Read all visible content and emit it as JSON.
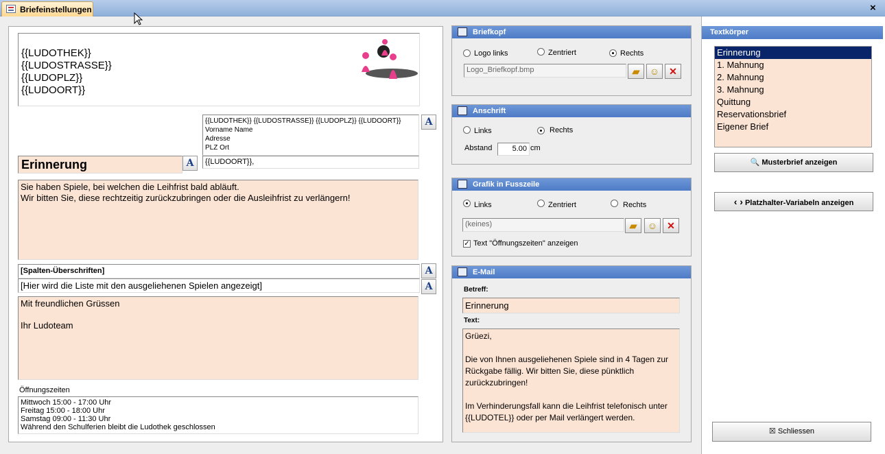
{
  "window": {
    "tab_title": "Briefeinstellungen",
    "close_glyph": "×"
  },
  "letter": {
    "header_lines": [
      "{{LUDOTHEK}}",
      "{{LUDOSTRASSE}}",
      "{{LUDOPLZ}}",
      "{{LUDOORT}}"
    ],
    "address_lines": [
      "{{LUDOTHEK}} {{LUDOSTRASSE}} {{LUDOPLZ}} {{LUDOORT}}",
      "Vorname Name",
      "Adresse",
      "PLZ Ort"
    ],
    "place_date": "{{LUDOORT}},",
    "subject": "Erinnerung",
    "body": "Sie haben Spiele, bei welchen die Leihfrist bald abläuft.\nWir bitten Sie, diese rechtzeitig zurückzubringen oder die Ausleihfrist zu verlängern!",
    "columns_header": "[Spalten-Überschriften]",
    "list_placeholder": "[Hier wird die Liste mit den ausgeliehenen Spielen angezeigt]",
    "closing": "Mit freundlichen Grüssen\n\nIhr Ludoteam",
    "hours_label": "Öffnungszeiten",
    "hours_lines": [
      "Mittwoch 15:00 - 17:00 Uhr",
      "Freitag 15:00 - 18:00 Uhr",
      "Samstag 09:00 - 11:30 Uhr",
      "Während den Schulferien bleibt die Ludothek geschlossen"
    ],
    "font_button": "A"
  },
  "briefkopf": {
    "title": "Briefkopf",
    "options": [
      "Logo links",
      "Zentriert",
      "Rechts"
    ],
    "selected": "Rechts",
    "file": "Logo_Briefkopf.bmp"
  },
  "anschrift": {
    "title": "Anschrift",
    "options": [
      "Links",
      "Rechts"
    ],
    "selected": "Rechts",
    "distance_label": "Abstand",
    "distance_value": "5.00",
    "distance_unit": "cm"
  },
  "fusszeile": {
    "title": "Grafik in Fusszeile",
    "options": [
      "Links",
      "Zentriert",
      "Rechts"
    ],
    "selected": "Links",
    "file": "(keines)",
    "checkbox_label": "Text \"Öffnungszeiten\" anzeigen",
    "checkbox_checked": true
  },
  "email": {
    "title": "E-Mail",
    "subject_label": "Betreff:",
    "subject": "Erinnerung",
    "text_label": "Text:",
    "text": "Grüezi,\n\nDie von Ihnen ausgeliehenen Spiele sind in 4 Tagen zur Rückgabe fällig. Wir bitten Sie, diese pünktlich zurückzubringen!\n\nIm Verhinderungsfall kann die Leihfrist telefonisch unter {{LUDOTEL}} oder per Mail verlängert werden."
  },
  "textkoerper": {
    "title": "Textkörper",
    "items": [
      "Erinnerung",
      "1. Mahnung",
      "2. Mahnung",
      "3. Mahnung",
      "Quittung",
      "Reservationsbrief",
      "Eigener Brief"
    ],
    "selected": "Erinnerung"
  },
  "buttons": {
    "preview": "Musterbrief anzeigen",
    "placeholders": "Platzhalter-Variabeln anzeigen",
    "close": "Schliessen"
  },
  "icons": {
    "tab": "form-icon",
    "open": "folder-open-icon",
    "smiley": "smiley-icon",
    "delete": "delete-x-icon",
    "mail": "envelope-icon",
    "magnifier": "magnifier-icon",
    "code": "angle-brackets-icon",
    "close": "close-x-icon"
  },
  "colors": {
    "header_blue": "#5582cc",
    "peach": "#fce4d4",
    "selected_bg": "#0a246a"
  }
}
